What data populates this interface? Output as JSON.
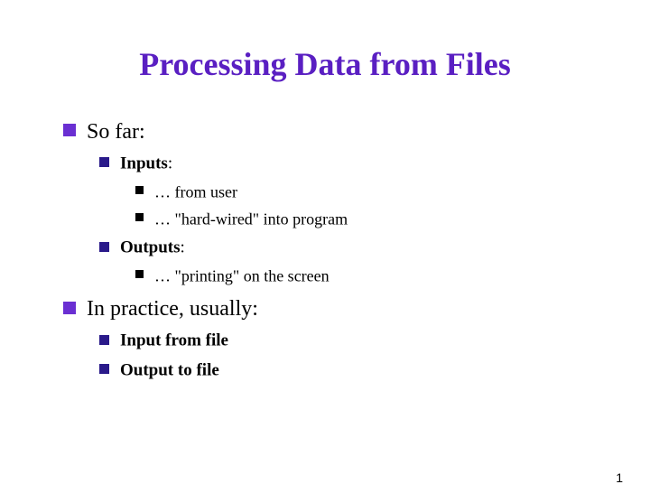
{
  "title": "Processing Data from Files",
  "items": {
    "sofar": "So far:",
    "inputs": "Inputs",
    "inputs_colon": ":",
    "from_user": "… from user",
    "hardwired": "… \"hard-wired\" into program",
    "outputs": "Outputs",
    "outputs_colon": ":",
    "printing": "… \"printing\" on the screen",
    "inpractice": "In practice, usually:",
    "input_file": "Input from file",
    "output_file": "Output to file"
  },
  "page_number": "1"
}
